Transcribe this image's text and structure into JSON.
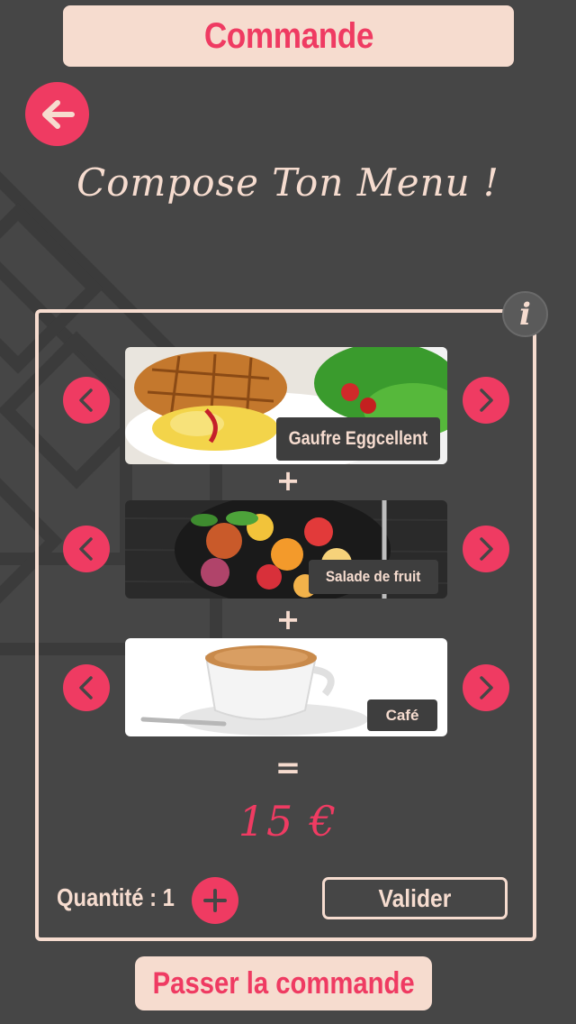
{
  "header": {
    "title": "Commande"
  },
  "subtitle": "Compose Ton Menu !",
  "info_symbol": "i",
  "menu": {
    "items": [
      {
        "label": "Gaufre Eggcellent",
        "category": "plat"
      },
      {
        "label": "Salade de fruit",
        "category": "dessert"
      },
      {
        "label": "Café",
        "category": "boisson"
      }
    ],
    "plus_symbol": "+",
    "equals_symbol": "=",
    "price": "15 €"
  },
  "quantity": {
    "label": "Quantité : 1"
  },
  "buttons": {
    "valider": "Valider",
    "passer_commande": "Passer la commande"
  },
  "colors": {
    "background": "#464646",
    "accent": "#ef3b62",
    "cream": "#f6dccf",
    "label_bg": "#3e3e3e"
  },
  "icons": [
    "back-arrow-icon",
    "info-icon",
    "chevron-left-icon",
    "chevron-right-icon",
    "plus-icon"
  ]
}
